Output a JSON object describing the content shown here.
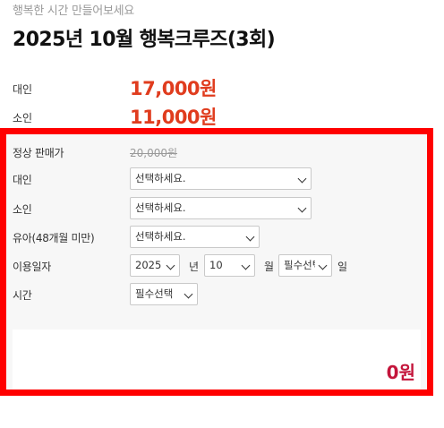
{
  "header": {
    "subtitle": "행복한 시간 만들어보세요",
    "title": "2025년 10월 행복크루즈(3회)"
  },
  "prices": [
    {
      "label": "대인",
      "value": "17,000원"
    },
    {
      "label": "소인",
      "value": "11,000원"
    }
  ],
  "order": {
    "regular_label": "정상 판매가",
    "regular_price": "20,000원",
    "adult": {
      "label": "대인",
      "selected": "선택하세요."
    },
    "child": {
      "label": "소인",
      "selected": "선택하세요."
    },
    "infant": {
      "label": "유아(48개월 미만)",
      "selected": "선택하세요."
    },
    "date": {
      "label": "이용일자",
      "year": "2025",
      "year_unit": "년",
      "month": "10",
      "month_unit": "월",
      "day": "필수선택",
      "day_unit": "일"
    },
    "time": {
      "label": "시간",
      "selected": "필수선택"
    },
    "total": "0원"
  },
  "colors": {
    "price": "#e03c1e",
    "total": "#c4153b",
    "highlight_border": "#ff0000"
  }
}
